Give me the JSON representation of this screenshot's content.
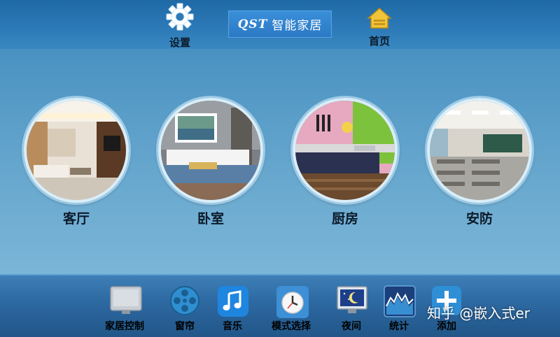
{
  "header": {
    "settings_label": "设置",
    "brand_code": "QST",
    "brand_name": "智能家居",
    "home_label": "首页"
  },
  "rooms": [
    {
      "label": "客厅"
    },
    {
      "label": "卧室"
    },
    {
      "label": "厨房"
    },
    {
      "label": "安防"
    }
  ],
  "dock": {
    "items": [
      {
        "label": "家居控制",
        "icon": "monitor-icon"
      },
      {
        "label": "窗帘",
        "icon": "film-reel-icon"
      },
      {
        "label": "音乐",
        "icon": "music-note-icon"
      },
      {
        "label": "模式选择",
        "icon": "clock-icon"
      },
      {
        "label": "夜间",
        "icon": "night-moon-icon"
      },
      {
        "label": "统计",
        "icon": "chart-icon"
      },
      {
        "label": "添加",
        "icon": "plus-icon"
      }
    ]
  },
  "watermark": "知乎 @嵌入式er",
  "colors": {
    "accent": "#2b79c4",
    "header": "#1f6aa6",
    "dock": "#2e6aa3"
  }
}
